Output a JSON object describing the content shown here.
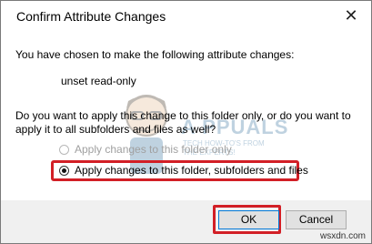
{
  "dialog": {
    "title": "Confirm Attribute Changes",
    "close_glyph": "✕"
  },
  "content": {
    "line1": "You have chosen to make the following attribute changes:",
    "change": "unset read-only",
    "question_line1": "Do you want to apply this change to this folder only, or do you want to",
    "question_line2": "apply it to all subfolders and files as well?"
  },
  "options": [
    {
      "label": "Apply changes to this folder only",
      "selected": false,
      "enabled": false
    },
    {
      "label": "Apply changes to this folder, subfolders and files",
      "selected": true,
      "enabled": true
    }
  ],
  "buttons": {
    "ok": "OK",
    "cancel": "Cancel"
  },
  "watermark": {
    "brand": "A PPUALS",
    "tagline_1": "TECH HOW-TO'S FROM",
    "tagline_2": "THE EXPERTS!"
  },
  "site": "wsxdn.com",
  "colors": {
    "highlight": "#d21f26",
    "ok_border": "#0078d7",
    "footer_bg": "#f0f0f0"
  }
}
